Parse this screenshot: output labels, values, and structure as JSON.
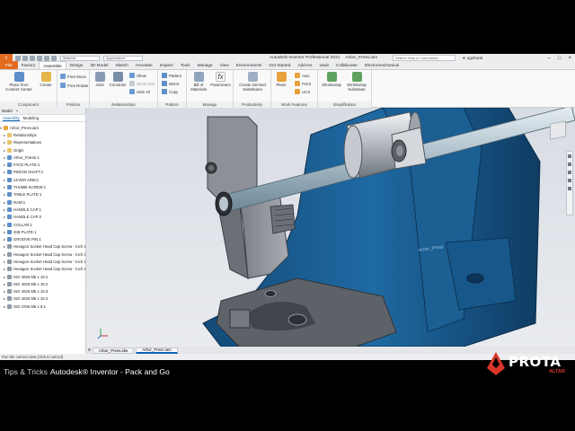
{
  "titlebar": {
    "logo": "I",
    "material": "Material",
    "appearance": "Appearance",
    "app_title": "Autodesk Inventor Professional 2021",
    "doc_title": "Arbor_Press.iam",
    "search_placeholder": "Search Help & Commands...",
    "user": "ogofrank"
  },
  "ribbon_tabs": [
    "File",
    "Factory",
    "Assemble",
    "Design",
    "3D Model",
    "Sketch",
    "Annotate",
    "Inspect",
    "Tools",
    "Manage",
    "View",
    "Environments",
    "Get Started",
    "Add-Ins",
    "Vault",
    "Collaborate",
    "Electromechanical"
  ],
  "ribbon": {
    "component": {
      "label": "Component",
      "place": "Place from\nContent Center",
      "create": "Create"
    },
    "position": {
      "label": "Position",
      "free_move": "Free Move",
      "free_rotate": "Free Rotate"
    },
    "relationships": {
      "label": "Relationships",
      "joint": "Joint",
      "constrain": "Constrain",
      "show": "Show",
      "show_sick": "Show Sick",
      "hide_all": "Hide All"
    },
    "pattern": {
      "label": "Pattern",
      "pattern": "Pattern",
      "mirror": "Mirror",
      "copy": "Copy"
    },
    "manage": {
      "label": "Manage",
      "bom": "Bill of\nMaterials",
      "parameters": "Parameters"
    },
    "productivity": {
      "label": "Productivity",
      "create_derived": "Create Derived\nSubstitutes"
    },
    "work_features": {
      "label": "Work Features",
      "plane": "Plane",
      "axis": "Axis",
      "point": "Point",
      "ucs": "UCS"
    },
    "simplification": {
      "label": "Simplification",
      "shrinkwrap": "Shrinkwrap",
      "shrinkwrap_sub": "Shrinkwrap\nSubstitute"
    }
  },
  "browser": {
    "header": "Model",
    "tabs": [
      "Assembly",
      "Modeling"
    ],
    "root": "Arbor_Press.iam",
    "items": [
      "Relationships",
      "Representations",
      "Origin",
      "Arbor_Frame:1",
      "FACE PLATE:1",
      "PINION SHAFT:1",
      "LEVER ARM:1",
      "THUMB SCREW:1",
      "TABLE PLATE:1",
      "RAM:1",
      "HANDLE CAP:1",
      "HANDLE CAP:2",
      "COLLAR:1",
      "GIB PLATE:1",
      "GROOVE PIN:1",
      "Hexagon Socket Head Cap Screw - Inch 1",
      "Hexagon Socket Head Cap Screw - Inch 1",
      "Hexagon Socket Head Cap Screw - Inch 1",
      "Hexagon Socket Head Cap Screw - Inch 1",
      "ISO 4026 M5 x 16:1",
      "ISO 4026 M5 x 16:2",
      "ISO 4026 M5 x 16:3",
      "ISO 4026 M5 x 16:4",
      "ISO 4766 M5 x 5:1"
    ]
  },
  "viewport": {
    "frame_label": "Arbor_Press"
  },
  "doc_tabs": [
    "Arbor_Press.idw",
    "Arbor_Press.iam"
  ],
  "status": "Pan the current view (click to cancel)",
  "caption": {
    "prefix": "Tips & Tricks",
    "product": "Autodesk® Inventor - Pack and Go"
  },
  "brand": {
    "name": "PROTA",
    "sub": "ALTAR"
  },
  "colors": {
    "accent": "#0a63b6",
    "file_tab": "#e36b1f",
    "frame_blue": "#1f5d8f",
    "brand_red": "#d9362b"
  }
}
